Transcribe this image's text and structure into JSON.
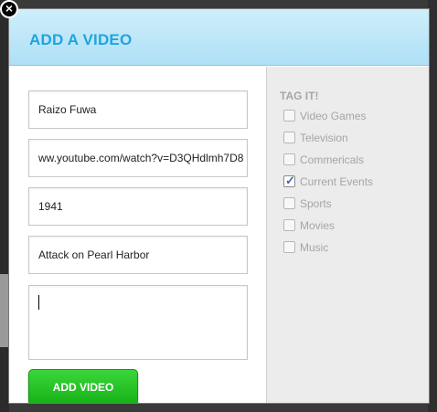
{
  "dialog": {
    "title": "ADD A VIDEO",
    "close_glyph": "×"
  },
  "form": {
    "name_value": "Raizo Fuwa",
    "url_value": "ww.youtube.com/watch?v=D3QHdlmh7D8",
    "year_value": "1941",
    "event_value": "Attack on Pearl Harbor",
    "notes_value": "",
    "submit_label": "ADD VIDEO"
  },
  "tags": {
    "title": "TAG IT!",
    "items": [
      {
        "label": "Video Games",
        "checked": false
      },
      {
        "label": "Television",
        "checked": false
      },
      {
        "label": "Commericals",
        "checked": false
      },
      {
        "label": "Current Events",
        "checked": true
      },
      {
        "label": "Sports",
        "checked": false
      },
      {
        "label": "Movies",
        "checked": false
      },
      {
        "label": "Music",
        "checked": false
      }
    ]
  },
  "colors": {
    "title_blue": "#1ea5de",
    "button_green": "#16b116"
  }
}
